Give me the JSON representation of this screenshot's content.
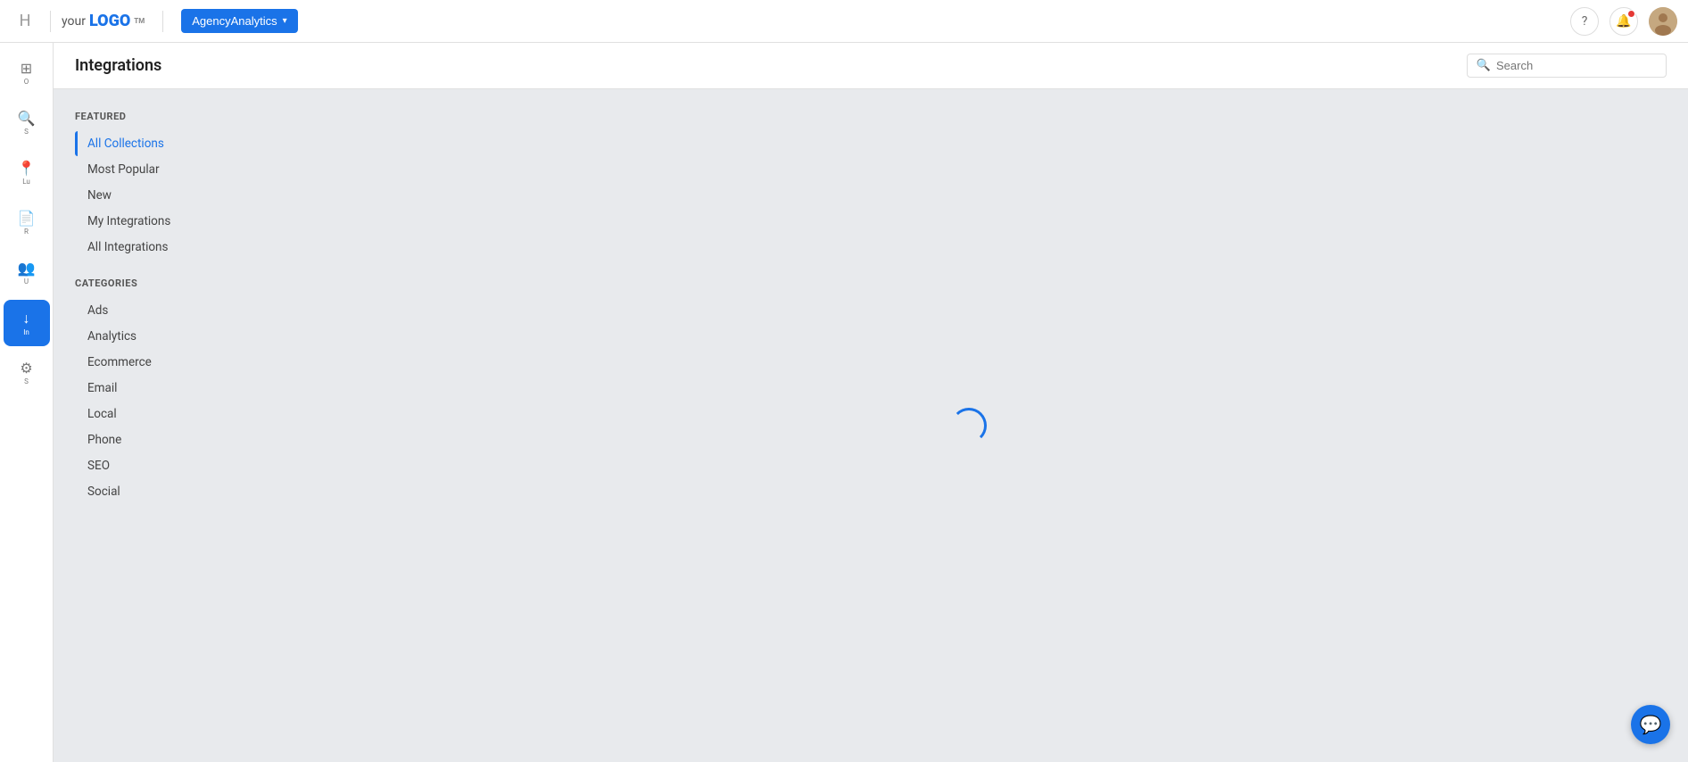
{
  "navbar": {
    "home_label": "H",
    "logo_your": "your",
    "logo_logo": "LOGO",
    "logo_tm": "TM",
    "agency_btn_label": "AgencyAnalytics",
    "search_placeholder": "Search"
  },
  "sidebar": {
    "items": [
      {
        "id": "home",
        "icon": "⊞",
        "label": "O"
      },
      {
        "id": "search",
        "icon": "🔍",
        "label": "S"
      },
      {
        "id": "location",
        "icon": "📍",
        "label": "Lu"
      },
      {
        "id": "reports",
        "icon": "📄",
        "label": "R"
      },
      {
        "id": "users",
        "icon": "👥",
        "label": "U"
      },
      {
        "id": "integrations",
        "icon": "↓",
        "label": "In",
        "active": true
      },
      {
        "id": "settings",
        "icon": "⚙",
        "label": "S"
      }
    ]
  },
  "page": {
    "title": "Integrations"
  },
  "integrations_nav": {
    "featured_section": "FEATURED",
    "categories_section": "CATEGORIES",
    "featured_items": [
      {
        "id": "all-collections",
        "label": "All Collections",
        "active": true
      },
      {
        "id": "most-popular",
        "label": "Most Popular"
      },
      {
        "id": "new",
        "label": "New"
      },
      {
        "id": "my-integrations",
        "label": "My Integrations"
      },
      {
        "id": "all-integrations",
        "label": "All Integrations"
      }
    ],
    "category_items": [
      {
        "id": "ads",
        "label": "Ads"
      },
      {
        "id": "analytics",
        "label": "Analytics"
      },
      {
        "id": "ecommerce",
        "label": "Ecommerce"
      },
      {
        "id": "email",
        "label": "Email"
      },
      {
        "id": "local",
        "label": "Local"
      },
      {
        "id": "phone",
        "label": "Phone"
      },
      {
        "id": "seo",
        "label": "SEO"
      },
      {
        "id": "social",
        "label": "Social"
      }
    ]
  }
}
